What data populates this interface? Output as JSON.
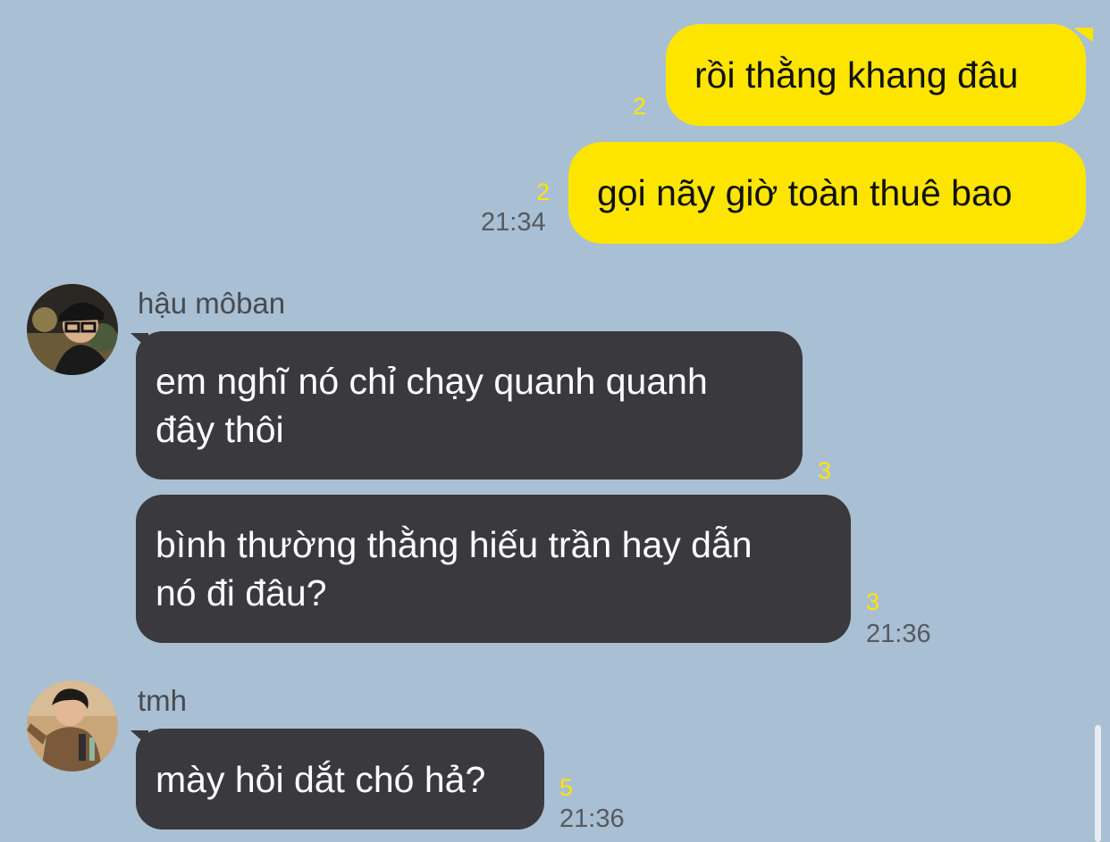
{
  "messages": [
    {
      "id": 1,
      "direction": "outgoing",
      "text": "rồi thằng khang đâu",
      "unread": "2"
    },
    {
      "id": 2,
      "direction": "outgoing",
      "text": "gọi nãy giờ toàn thuê bao",
      "unread": "2",
      "time": "21:34"
    },
    {
      "id": 3,
      "direction": "incoming",
      "sender": "hậu môban",
      "lines": [
        "em nghĩ nó chỉ chạy quanh quanh",
        "đây thôi"
      ],
      "unread": "3"
    },
    {
      "id": 4,
      "direction": "incoming",
      "lines": [
        "bình thường thằng hiếu trần hay dẫn",
        "nó đi đâu?"
      ],
      "unread": "3",
      "time": "21:36"
    },
    {
      "id": 5,
      "direction": "incoming",
      "sender": "tmh",
      "lines": [
        "mày hỏi dắt chó hả?"
      ],
      "unread": "5",
      "time": "21:36"
    }
  ],
  "colors": {
    "background": "#a9bfd3",
    "outgoing_bubble": "#fee500",
    "incoming_bubble": "#3a393d",
    "unread_count": "#fee500"
  },
  "avatars": {
    "hau_moban": "avatar-photo-icon",
    "tmh": "avatar-photo-icon"
  }
}
